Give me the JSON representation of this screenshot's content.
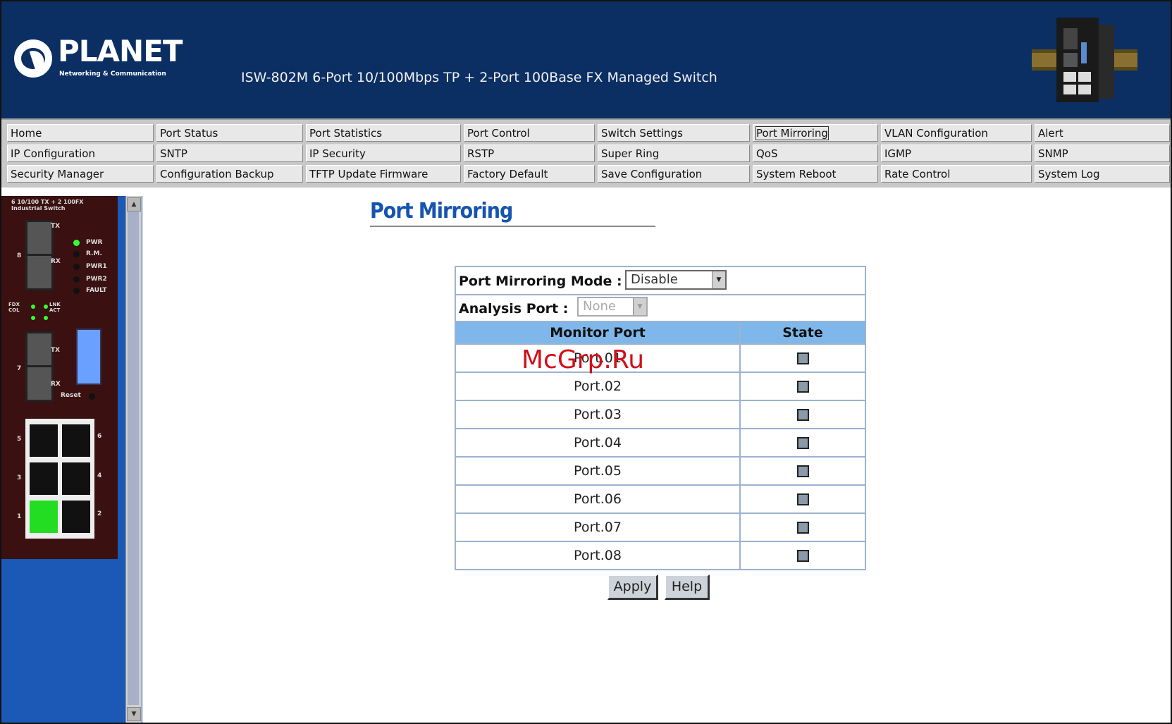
{
  "header": {
    "logo_word": "PLANET",
    "logo_tagline": "Networking & Communication",
    "product_title": "ISW-802M 6-Port 10/100Mbps TP + 2-Port 100Base FX Managed Switch"
  },
  "menu": {
    "rows": [
      [
        "Home",
        "Port Status",
        "Port Statistics",
        "Port Control",
        "Switch Settings",
        "Port Mirroring",
        "VLAN Configuration",
        "Alert"
      ],
      [
        "IP Configuration",
        "SNTP",
        "IP Security",
        "RSTP",
        "Super Ring",
        "QoS",
        "IGMP",
        "SNMP"
      ],
      [
        "Security Manager",
        "Configuration Backup",
        "TFTP Update Firmware",
        "Factory Default",
        "Save Configuration",
        "System Reboot",
        "Rate Control",
        "System Log"
      ]
    ],
    "active": "Port Mirroring"
  },
  "device_panel": {
    "model_label": "6 10/100 TX + 2 100FX Industrial Switch",
    "leds": [
      "PWR",
      "R.M.",
      "PWR1",
      "PWR2",
      "FAULT"
    ],
    "fx_labels": [
      "FDX COL",
      "LNK ACT"
    ],
    "reset_label": "Reset",
    "port_numbers": [
      "8",
      "7",
      "5",
      "6",
      "3",
      "4",
      "1",
      "2"
    ],
    "sfp_labels": [
      "TX",
      "RX",
      "TX",
      "RX"
    ]
  },
  "main": {
    "page_title": "Port Mirroring",
    "mode_label": "Port Mirroring Mode :",
    "mode_value": "Disable",
    "analysis_label": "Analysis Port :",
    "analysis_value": "None",
    "col_monitor": "Monitor Port",
    "col_state": "State",
    "ports": [
      "Port.01",
      "Port.02",
      "Port.03",
      "Port.04",
      "Port.05",
      "Port.06",
      "Port.07",
      "Port.08"
    ],
    "apply_label": "Apply",
    "help_label": "Help"
  },
  "watermark": "McGrp.Ru",
  "colors": {
    "header_bg": "#0b2e63",
    "sidebar_bg": "#1c58b5",
    "table_header_bg": "#7fb7ea",
    "title_color": "#1554b0",
    "watermark_color": "#d0101a"
  }
}
